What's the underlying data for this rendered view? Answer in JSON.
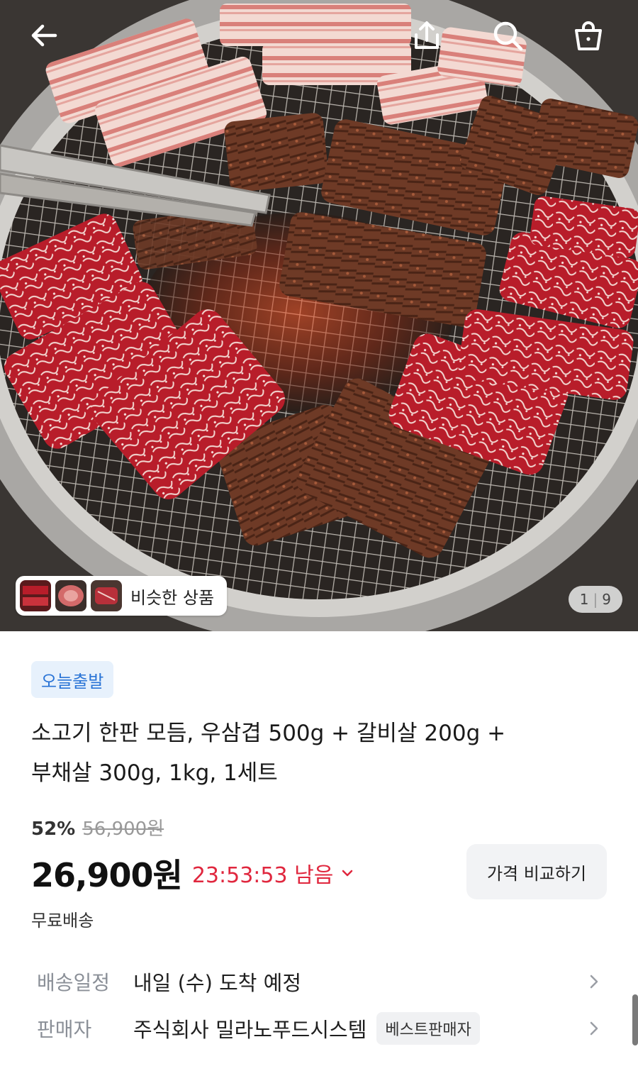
{
  "header": {
    "back_icon": "arrow-left-icon",
    "share_icon": "share-icon",
    "search_icon": "search-icon",
    "cart_icon": "shopping-bag-icon"
  },
  "gallery": {
    "similar_products_label": "비슷한 상품",
    "page_current": "1",
    "page_total": "9"
  },
  "product": {
    "badge": "오늘출발",
    "title_line1": "소고기 한판 모듬, 우삼겹 500g + 갈비살 200g +",
    "title_line2": "부채살 300g, 1kg, 1세트",
    "discount_rate": "52%",
    "original_price": "56,900원",
    "sale_price": "26,900원",
    "countdown": "23:53:53 남음",
    "compare_label": "가격 비교하기",
    "shipping_fee": "무료배송"
  },
  "info_rows": [
    {
      "key": "배송일정",
      "value": "내일 (수) 도착 예정"
    },
    {
      "key": "판매자",
      "value": "주식회사 밀라노푸드시스템",
      "badge": "베스트판매자"
    }
  ],
  "colors": {
    "accent_blue": "#2a74d6",
    "countdown_red": "#e0273e",
    "badge_bg": "#e7f1fc"
  }
}
